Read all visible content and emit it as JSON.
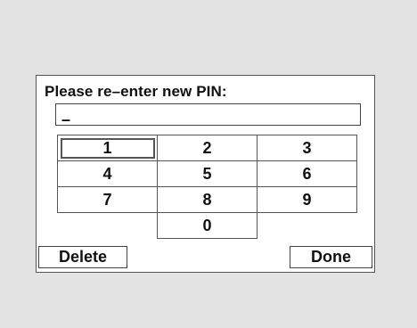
{
  "dialog": {
    "prompt": "Please re–enter new PIN:",
    "pin_value": "–",
    "keys": [
      "1",
      "2",
      "3",
      "4",
      "5",
      "6",
      "7",
      "8",
      "9",
      "0"
    ],
    "selected_key": "1",
    "delete_label": "Delete",
    "done_label": "Done"
  }
}
